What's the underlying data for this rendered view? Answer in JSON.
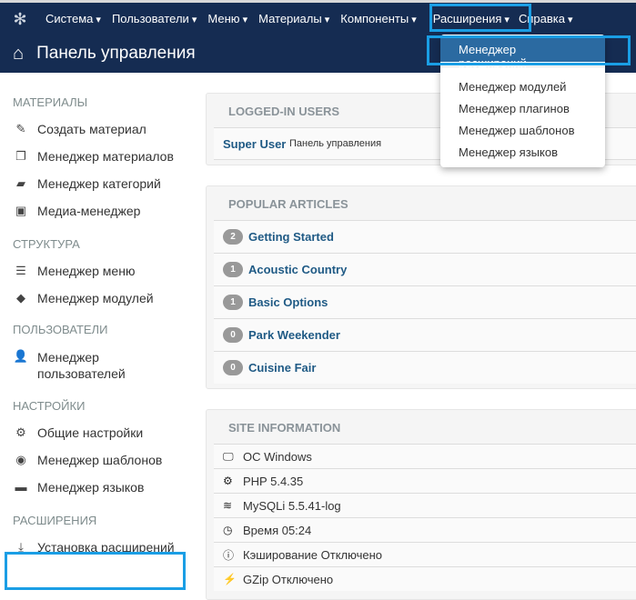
{
  "nav": {
    "items": [
      "Система",
      "Пользователи",
      "Меню",
      "Материалы",
      "Компоненты",
      "Расширения",
      "Справка"
    ]
  },
  "header": {
    "title": "Панель управления"
  },
  "dropdown": {
    "items": [
      "Менеджер расширений",
      "Менеджер модулей",
      "Менеджер плагинов",
      "Менеджер шаблонов",
      "Менеджер языков"
    ]
  },
  "sidebar": {
    "sections": [
      {
        "title": "МАТЕРИАЛЫ",
        "items": [
          {
            "icon": "pencil-icon",
            "label": "Создать материал"
          },
          {
            "icon": "copy-icon",
            "label": "Менеджер материалов"
          },
          {
            "icon": "folder-icon",
            "label": "Менеджер категорий"
          },
          {
            "icon": "image-icon",
            "label": "Медиа-менеджер"
          }
        ]
      },
      {
        "title": "СТРУКТУРА",
        "items": [
          {
            "icon": "list-icon",
            "label": "Менеджер меню"
          },
          {
            "icon": "cube-icon",
            "label": "Менеджер модулей"
          }
        ]
      },
      {
        "title": "ПОЛЬЗОВАТЕЛИ",
        "items": [
          {
            "icon": "users-icon",
            "label": "Менеджер пользователей"
          }
        ]
      },
      {
        "title": "НАСТРОЙКИ",
        "items": [
          {
            "icon": "cog-icon",
            "label": "Общие настройки"
          },
          {
            "icon": "eye-icon",
            "label": "Менеджер шаблонов"
          },
          {
            "icon": "comments-icon",
            "label": "Менеджер языков"
          }
        ]
      },
      {
        "title": "РАСШИРЕНИЯ",
        "items": [
          {
            "icon": "download-icon",
            "label": "Установка расширений"
          }
        ]
      }
    ]
  },
  "logged_in": {
    "title": "LOGGED-IN USERS",
    "user": "Super User",
    "location": "Панель управления"
  },
  "popular": {
    "title": "POPULAR ARTICLES",
    "items": [
      {
        "hits": "2",
        "title": "Getting Started"
      },
      {
        "hits": "1",
        "title": "Acoustic Country"
      },
      {
        "hits": "1",
        "title": "Basic Options"
      },
      {
        "hits": "0",
        "title": "Park Weekender"
      },
      {
        "hits": "0",
        "title": "Cuisine Fair"
      }
    ]
  },
  "site_info": {
    "title": "SITE INFORMATION",
    "items": [
      {
        "icon": "monitor-icon",
        "label": "ОС Windows"
      },
      {
        "icon": "cogs-icon",
        "label": "PHP 5.4.35"
      },
      {
        "icon": "database-icon",
        "label": "MySQLi 5.5.41-log"
      },
      {
        "icon": "clock-icon",
        "label": "Время 05:24"
      },
      {
        "icon": "info-icon",
        "label": "Кэширование Отключено"
      },
      {
        "icon": "bolt-icon",
        "label": "GZip Отключено"
      }
    ]
  }
}
